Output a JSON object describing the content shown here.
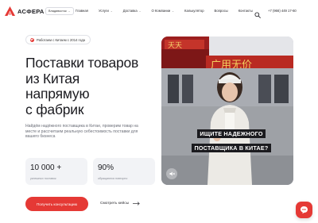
{
  "header": {
    "logo": "АСФЕРА",
    "city": "Владивосток",
    "nav": [
      {
        "label": "Главная",
        "has_menu": false
      },
      {
        "label": "Услуги",
        "has_menu": true
      },
      {
        "label": "Доставка",
        "has_menu": true
      },
      {
        "label": "О Компании",
        "has_menu": true
      },
      {
        "label": "Калькулятор",
        "has_menu": false
      },
      {
        "label": "Вопросы",
        "has_menu": false
      },
      {
        "label": "Контакты",
        "has_menu": false
      }
    ],
    "phone": "+7 (966) 449 17-60"
  },
  "hero": {
    "badge": "Работаем с Китаем с 2014 года",
    "title_lines": [
      "Поставки товаров",
      "из Китая",
      "напрямую",
      "с фабрик"
    ],
    "subtitle": "Найдём надёжного поставщика в Китае, проверим товар на месте и рассчитаем реальную себестоимость поставки для вашего бизнеса",
    "stats": [
      {
        "value": "10 000 +",
        "label": "успешных поставок"
      },
      {
        "value": "90%",
        "label": "обращаются повторно"
      }
    ],
    "cta_label": "Получить консультацию",
    "cases_label": "Смотреть кейсы"
  },
  "video": {
    "caption_lines": [
      "ИЩИТЕ НАДЕЖНОГО",
      "ПОСТАВЩИКА В КИТАЕ?"
    ]
  },
  "colors": {
    "accent": "#e53935",
    "text": "#1b1b20",
    "muted": "#6b6e78",
    "card": "#f2f3f6"
  }
}
